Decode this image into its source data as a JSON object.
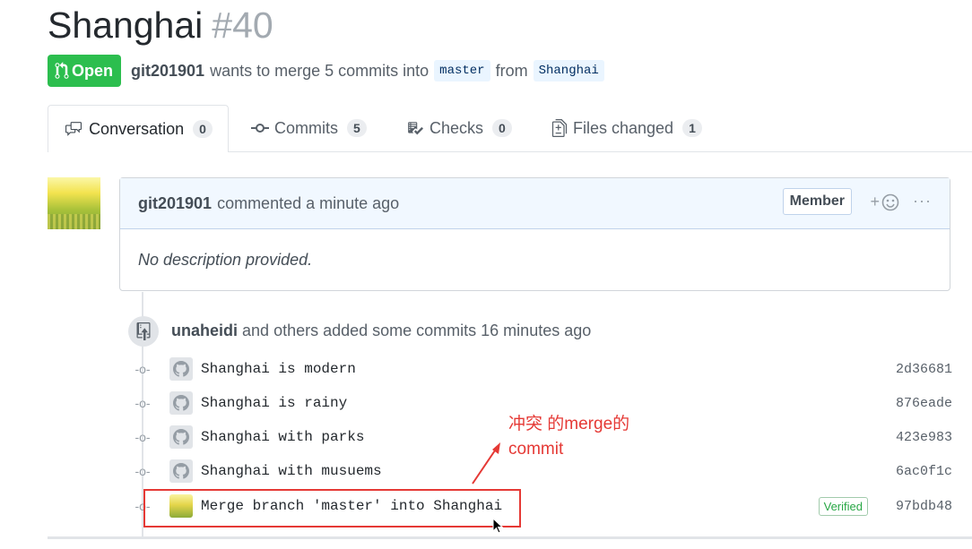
{
  "pr": {
    "title": "Shanghai",
    "number": "#40",
    "state": "Open",
    "author": "git201901",
    "merge_text": "wants to merge 5 commits into",
    "base_branch": "master",
    "from_text": "from",
    "head_branch": "Shanghai"
  },
  "tabs": [
    {
      "label": "Conversation",
      "count": "0",
      "icon": "comment-discussion-icon"
    },
    {
      "label": "Commits",
      "count": "5",
      "icon": "git-commit-icon"
    },
    {
      "label": "Checks",
      "count": "0",
      "icon": "checklist-icon"
    },
    {
      "label": "Files changed",
      "count": "1",
      "icon": "file-diff-icon"
    }
  ],
  "comment": {
    "author": "git201901",
    "action": "commented a minute ago",
    "role": "Member",
    "body": "No description provided."
  },
  "push_event": {
    "author": "unaheidi",
    "text": "and others added some commits 16 minutes ago"
  },
  "commits": [
    {
      "message": "Shanghai is modern",
      "sha": "2d36681"
    },
    {
      "message": "Shanghai is rainy",
      "sha": "876eade"
    },
    {
      "message": "Shanghai with parks",
      "sha": "423e983"
    },
    {
      "message": "Shanghai with musuems",
      "sha": "6ac0f1c"
    },
    {
      "message": "Merge branch 'master' into Shanghai",
      "sha": "97bdb48",
      "verified": "Verified"
    }
  ],
  "annotation": {
    "line1": "冲突 的merge的",
    "line2": "commit",
    "color": "#e53935"
  },
  "colors": {
    "open_green": "#2cbe4e",
    "header_blue": "#f1f8ff",
    "text_gray": "#586069"
  }
}
